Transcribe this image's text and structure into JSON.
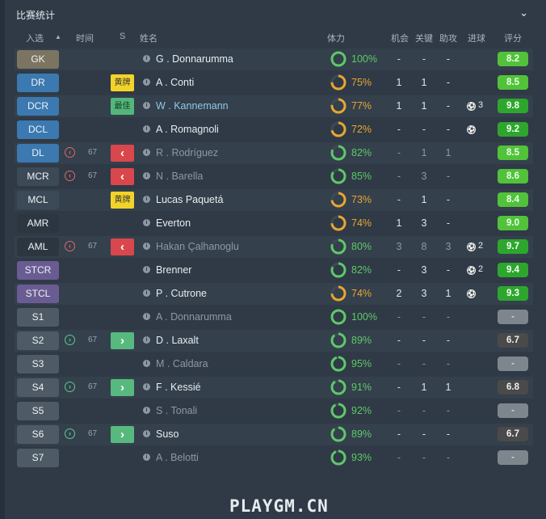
{
  "panel": {
    "title": "比赛统计"
  },
  "headers": {
    "selection": "入选",
    "time": "时间",
    "s": "S",
    "name": "姓名",
    "condition": "体力",
    "chances": "机会",
    "key": "关键",
    "assists": "助攻",
    "goals": "进球",
    "rating": "评分"
  },
  "colors": {
    "pos_gk": "#7b7461",
    "pos_def": "#3b79b0",
    "pos_mid": "#3c4a57",
    "pos_att": "#2c3640",
    "pos_st": "#6a5c93",
    "pos_sub": "#4e5a65",
    "cond_high": "#5fc86a",
    "cond_mid": "#e9a630",
    "rating_good": "#52c23a"
  },
  "players": [
    {
      "pos": "GK",
      "name": "G . Donnarumma",
      "cond": "100%",
      "cond_value": 1.0,
      "chances": "-",
      "key": "-",
      "assists": "-",
      "goals": "",
      "rating": "8.2",
      "rating_class": "good",
      "style": "gk",
      "name_style": "normal"
    },
    {
      "pos": "DR",
      "badge": "黄牌",
      "badge_type": "yellow",
      "name": "A . Conti",
      "cond": "75%",
      "cond_value": 0.75,
      "chances": "1",
      "key": "1",
      "assists": "-",
      "goals": "",
      "rating": "8.5",
      "rating_class": "good",
      "style": "def",
      "name_style": "normal"
    },
    {
      "pos": "DCR",
      "badge": "最佳",
      "badge_type": "best",
      "name": "W . Kannemann",
      "cond": "77%",
      "cond_value": 0.77,
      "chances": "1",
      "key": "1",
      "assists": "-",
      "goals": "3",
      "rating": "9.8",
      "rating_class": "great",
      "style": "def",
      "name_style": "hl"
    },
    {
      "pos": "DCL",
      "name": "A . Romagnoli",
      "cond": "72%",
      "cond_value": 0.72,
      "chances": "-",
      "key": "-",
      "assists": "-",
      "goals": "ball",
      "rating": "9.2",
      "rating_class": "great",
      "style": "def",
      "name_style": "normal"
    },
    {
      "pos": "DL",
      "sub": "out",
      "time": "67",
      "badge": "‹",
      "badge_type": "outarrow",
      "name": "R . Rodríguez",
      "cond": "82%",
      "cond_value": 0.82,
      "chances": "-",
      "key": "1",
      "assists": "1",
      "goals": "",
      "rating": "8.5",
      "rating_class": "good",
      "style": "def",
      "name_style": "dim"
    },
    {
      "pos": "MCR",
      "sub": "out",
      "time": "67",
      "badge": "‹",
      "badge_type": "outarrow",
      "name": "N . Barella",
      "cond": "85%",
      "cond_value": 0.85,
      "chances": "-",
      "key": "3",
      "assists": "-",
      "goals": "",
      "rating": "8.6",
      "rating_class": "good",
      "style": "mid",
      "name_style": "dim"
    },
    {
      "pos": "MCL",
      "badge": "黄牌",
      "badge_type": "yellow",
      "name": "Lucas Paquetá",
      "cond": "73%",
      "cond_value": 0.73,
      "chances": "-",
      "key": "1",
      "assists": "-",
      "goals": "",
      "rating": "8.4",
      "rating_class": "good",
      "style": "mid",
      "name_style": "normal"
    },
    {
      "pos": "AMR",
      "name": "Everton",
      "cond": "74%",
      "cond_value": 0.74,
      "chances": "1",
      "key": "3",
      "assists": "-",
      "goals": "",
      "rating": "9.0",
      "rating_class": "good",
      "style": "att",
      "name_style": "normal"
    },
    {
      "pos": "AML",
      "sub": "out",
      "time": "67",
      "badge": "‹",
      "badge_type": "outarrow",
      "name": "Hakan Çalhanoglu",
      "cond": "80%",
      "cond_value": 0.8,
      "chances": "3",
      "key": "8",
      "assists": "3",
      "goals": "2",
      "rating": "9.7",
      "rating_class": "great",
      "style": "att",
      "name_style": "dim"
    },
    {
      "pos": "STCR",
      "name": "Brenner",
      "cond": "82%",
      "cond_value": 0.82,
      "chances": "-",
      "key": "3",
      "assists": "-",
      "goals": "2",
      "rating": "9.4",
      "rating_class": "great",
      "style": "st",
      "name_style": "normal"
    },
    {
      "pos": "STCL",
      "name": "P . Cutrone",
      "cond": "74%",
      "cond_value": 0.74,
      "chances": "2",
      "key": "3",
      "assists": "1",
      "goals": "ball",
      "rating": "9.3",
      "rating_class": "great",
      "style": "st",
      "name_style": "normal"
    },
    {
      "pos": "S1",
      "name": "A . Donnarumma",
      "cond": "100%",
      "cond_value": 1.0,
      "chances": "-",
      "key": "-",
      "assists": "-",
      "goals": "",
      "rating": "-",
      "rating_class": "none",
      "style": "sub",
      "name_style": "dim"
    },
    {
      "pos": "S2",
      "sub": "in",
      "time": "67",
      "badge": "›",
      "badge_type": "inarrow",
      "name": "D . Laxalt",
      "cond": "89%",
      "cond_value": 0.89,
      "chances": "-",
      "key": "-",
      "assists": "-",
      "goals": "",
      "rating": "6.7",
      "rating_class": "mid",
      "style": "sub",
      "name_style": "normal"
    },
    {
      "pos": "S3",
      "name": "M . Caldara",
      "cond": "95%",
      "cond_value": 0.95,
      "chances": "-",
      "key": "-",
      "assists": "-",
      "goals": "",
      "rating": "-",
      "rating_class": "none",
      "style": "sub",
      "name_style": "dim"
    },
    {
      "pos": "S4",
      "sub": "in",
      "time": "67",
      "badge": "›",
      "badge_type": "inarrow",
      "name": "F . Kessié",
      "cond": "91%",
      "cond_value": 0.91,
      "chances": "-",
      "key": "1",
      "assists": "1",
      "goals": "",
      "rating": "6.8",
      "rating_class": "mid",
      "style": "sub",
      "name_style": "normal"
    },
    {
      "pos": "S5",
      "name": "S . Tonali",
      "cond": "92%",
      "cond_value": 0.92,
      "chances": "-",
      "key": "-",
      "assists": "-",
      "goals": "",
      "rating": "-",
      "rating_class": "none",
      "style": "sub",
      "name_style": "dim"
    },
    {
      "pos": "S6",
      "sub": "in",
      "time": "67",
      "badge": "›",
      "badge_type": "inarrow",
      "name": "Suso",
      "cond": "89%",
      "cond_value": 0.89,
      "chances": "-",
      "key": "-",
      "assists": "-",
      "goals": "",
      "rating": "6.7",
      "rating_class": "mid",
      "style": "sub",
      "name_style": "normal"
    },
    {
      "pos": "S7",
      "name": "A . Belotti",
      "cond": "93%",
      "cond_value": 0.93,
      "chances": "-",
      "key": "-",
      "assists": "-",
      "goals": "",
      "rating": "-",
      "rating_class": "none",
      "style": "sub",
      "name_style": "dim"
    }
  ],
  "watermark": "PLAYGM.CN"
}
